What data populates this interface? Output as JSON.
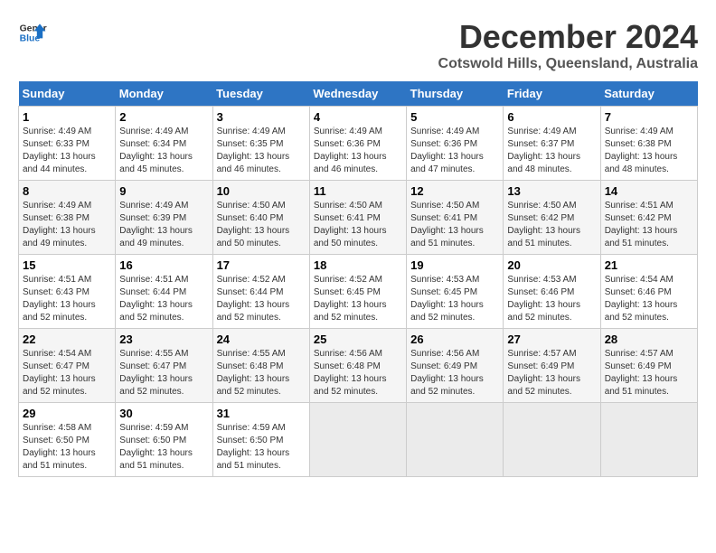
{
  "logo": {
    "line1": "General",
    "line2": "Blue"
  },
  "header": {
    "month": "December 2024",
    "location": "Cotswold Hills, Queensland, Australia"
  },
  "weekdays": [
    "Sunday",
    "Monday",
    "Tuesday",
    "Wednesday",
    "Thursday",
    "Friday",
    "Saturday"
  ],
  "weeks": [
    [
      {
        "day": "1",
        "info": "Sunrise: 4:49 AM\nSunset: 6:33 PM\nDaylight: 13 hours\nand 44 minutes."
      },
      {
        "day": "2",
        "info": "Sunrise: 4:49 AM\nSunset: 6:34 PM\nDaylight: 13 hours\nand 45 minutes."
      },
      {
        "day": "3",
        "info": "Sunrise: 4:49 AM\nSunset: 6:35 PM\nDaylight: 13 hours\nand 46 minutes."
      },
      {
        "day": "4",
        "info": "Sunrise: 4:49 AM\nSunset: 6:36 PM\nDaylight: 13 hours\nand 46 minutes."
      },
      {
        "day": "5",
        "info": "Sunrise: 4:49 AM\nSunset: 6:36 PM\nDaylight: 13 hours\nand 47 minutes."
      },
      {
        "day": "6",
        "info": "Sunrise: 4:49 AM\nSunset: 6:37 PM\nDaylight: 13 hours\nand 48 minutes."
      },
      {
        "day": "7",
        "info": "Sunrise: 4:49 AM\nSunset: 6:38 PM\nDaylight: 13 hours\nand 48 minutes."
      }
    ],
    [
      {
        "day": "8",
        "info": "Sunrise: 4:49 AM\nSunset: 6:38 PM\nDaylight: 13 hours\nand 49 minutes."
      },
      {
        "day": "9",
        "info": "Sunrise: 4:49 AM\nSunset: 6:39 PM\nDaylight: 13 hours\nand 49 minutes."
      },
      {
        "day": "10",
        "info": "Sunrise: 4:50 AM\nSunset: 6:40 PM\nDaylight: 13 hours\nand 50 minutes."
      },
      {
        "day": "11",
        "info": "Sunrise: 4:50 AM\nSunset: 6:41 PM\nDaylight: 13 hours\nand 50 minutes."
      },
      {
        "day": "12",
        "info": "Sunrise: 4:50 AM\nSunset: 6:41 PM\nDaylight: 13 hours\nand 51 minutes."
      },
      {
        "day": "13",
        "info": "Sunrise: 4:50 AM\nSunset: 6:42 PM\nDaylight: 13 hours\nand 51 minutes."
      },
      {
        "day": "14",
        "info": "Sunrise: 4:51 AM\nSunset: 6:42 PM\nDaylight: 13 hours\nand 51 minutes."
      }
    ],
    [
      {
        "day": "15",
        "info": "Sunrise: 4:51 AM\nSunset: 6:43 PM\nDaylight: 13 hours\nand 52 minutes."
      },
      {
        "day": "16",
        "info": "Sunrise: 4:51 AM\nSunset: 6:44 PM\nDaylight: 13 hours\nand 52 minutes."
      },
      {
        "day": "17",
        "info": "Sunrise: 4:52 AM\nSunset: 6:44 PM\nDaylight: 13 hours\nand 52 minutes."
      },
      {
        "day": "18",
        "info": "Sunrise: 4:52 AM\nSunset: 6:45 PM\nDaylight: 13 hours\nand 52 minutes."
      },
      {
        "day": "19",
        "info": "Sunrise: 4:53 AM\nSunset: 6:45 PM\nDaylight: 13 hours\nand 52 minutes."
      },
      {
        "day": "20",
        "info": "Sunrise: 4:53 AM\nSunset: 6:46 PM\nDaylight: 13 hours\nand 52 minutes."
      },
      {
        "day": "21",
        "info": "Sunrise: 4:54 AM\nSunset: 6:46 PM\nDaylight: 13 hours\nand 52 minutes."
      }
    ],
    [
      {
        "day": "22",
        "info": "Sunrise: 4:54 AM\nSunset: 6:47 PM\nDaylight: 13 hours\nand 52 minutes."
      },
      {
        "day": "23",
        "info": "Sunrise: 4:55 AM\nSunset: 6:47 PM\nDaylight: 13 hours\nand 52 minutes."
      },
      {
        "day": "24",
        "info": "Sunrise: 4:55 AM\nSunset: 6:48 PM\nDaylight: 13 hours\nand 52 minutes."
      },
      {
        "day": "25",
        "info": "Sunrise: 4:56 AM\nSunset: 6:48 PM\nDaylight: 13 hours\nand 52 minutes."
      },
      {
        "day": "26",
        "info": "Sunrise: 4:56 AM\nSunset: 6:49 PM\nDaylight: 13 hours\nand 52 minutes."
      },
      {
        "day": "27",
        "info": "Sunrise: 4:57 AM\nSunset: 6:49 PM\nDaylight: 13 hours\nand 52 minutes."
      },
      {
        "day": "28",
        "info": "Sunrise: 4:57 AM\nSunset: 6:49 PM\nDaylight: 13 hours\nand 51 minutes."
      }
    ],
    [
      {
        "day": "29",
        "info": "Sunrise: 4:58 AM\nSunset: 6:50 PM\nDaylight: 13 hours\nand 51 minutes."
      },
      {
        "day": "30",
        "info": "Sunrise: 4:59 AM\nSunset: 6:50 PM\nDaylight: 13 hours\nand 51 minutes."
      },
      {
        "day": "31",
        "info": "Sunrise: 4:59 AM\nSunset: 6:50 PM\nDaylight: 13 hours\nand 51 minutes."
      },
      {
        "day": "",
        "info": ""
      },
      {
        "day": "",
        "info": ""
      },
      {
        "day": "",
        "info": ""
      },
      {
        "day": "",
        "info": ""
      }
    ]
  ]
}
